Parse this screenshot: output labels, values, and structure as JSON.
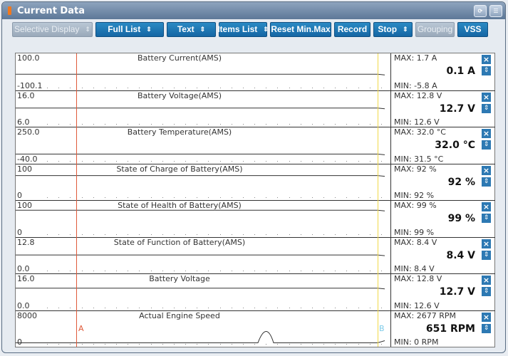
{
  "window": {
    "title": "Current Data"
  },
  "toolbar": {
    "buttons": [
      {
        "label": "Selective Display",
        "has_caret": true,
        "disabled": true
      },
      {
        "label": "Full List",
        "has_caret": true,
        "disabled": false
      },
      {
        "label": "Text",
        "has_caret": true,
        "disabled": false
      },
      {
        "label": "Items List",
        "has_caret": true,
        "disabled": false
      },
      {
        "label": "Reset Min.Max",
        "has_caret": false,
        "disabled": false
      },
      {
        "label": "Record",
        "has_caret": false,
        "disabled": false
      },
      {
        "label": "Stop",
        "has_caret": true,
        "disabled": false
      },
      {
        "label": "Grouping",
        "has_caret": false,
        "disabled": true
      },
      {
        "label": "VSS",
        "has_caret": false,
        "disabled": false
      }
    ]
  },
  "cursors": {
    "a": "A",
    "b": "B"
  },
  "items": [
    {
      "name": "Battery Current(AMS)",
      "ymax": "100.0",
      "ymin": "-100.1",
      "max": "MAX:   1.7 A",
      "min": "MIN:  -5.8 A",
      "value": "0.1 A",
      "level": 0.5
    },
    {
      "name": "Battery Voltage(AMS)",
      "ymax": "16.0",
      "ymin": "6.0",
      "max": "MAX:  12.8 V",
      "min": "MIN:  12.6 V",
      "value": "12.7 V",
      "level": 0.67
    },
    {
      "name": "Battery Temperature(AMS)",
      "ymax": "250.0",
      "ymin": "-40.0",
      "max": "MAX:  32.0 °C",
      "min": "MIN:  31.5 °C",
      "value": "32.0 °C",
      "level": 0.25
    },
    {
      "name": "State of Charge of Battery(AMS)",
      "ymax": "100",
      "ymin": "0",
      "max": "MAX:    92 %",
      "min": "MIN:    92 %",
      "value": "92 %",
      "level": 0.92
    },
    {
      "name": "State of Health of Battery(AMS)",
      "ymax": "100",
      "ymin": "0",
      "max": "MAX:    99 %",
      "min": "MIN:    99 %",
      "value": "99 %",
      "level": 0.99
    },
    {
      "name": "State of Function of Battery(AMS)",
      "ymax": "12.8",
      "ymin": "0.0",
      "max": "MAX:   8.4 V",
      "min": "MIN:   8.4 V",
      "value": "8.4 V",
      "level": 0.66
    },
    {
      "name": "Battery Voltage",
      "ymax": "16.0",
      "ymin": "0.0",
      "max": "MAX:  12.8 V",
      "min": "MIN:  12.6 V",
      "value": "12.7 V",
      "level": 0.79
    },
    {
      "name": "Actual Engine Speed",
      "ymax": "8000",
      "ymin": "0",
      "max": "MAX:  2677 RPM",
      "min": "MIN:     0 RPM",
      "value": "651 RPM",
      "level": 0.08
    }
  ],
  "colors": {
    "accent": "#1a6fae",
    "cursor_a": "#e05a3a",
    "cursor_b": "#f2d94a"
  },
  "icons": {
    "title_marker": "orange-bar-icon",
    "retry": "retry-icon",
    "menu": "menu-icon",
    "close": "close-icon",
    "updown": "updown-icon"
  }
}
